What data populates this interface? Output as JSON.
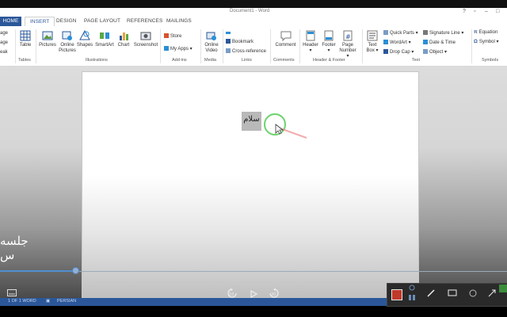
{
  "window": {
    "title": "Document1 - Word"
  },
  "tabs": [
    {
      "label": "HOME"
    },
    {
      "label": "INSERT"
    },
    {
      "label": "DESIGN"
    },
    {
      "label": "PAGE LAYOUT"
    },
    {
      "label": "REFERENCES"
    },
    {
      "label": "MAILINGS"
    }
  ],
  "ribbon": {
    "pages": {
      "partial_labels": [
        "age",
        "age",
        "eak"
      ]
    },
    "tables": {
      "table_label": "Table",
      "group_label": "Tables"
    },
    "illustrations": {
      "pictures": "Pictures",
      "online_pictures_1": "Online",
      "online_pictures_2": "Pictures",
      "shapes": "Shapes",
      "smartart": "SmartArt",
      "chart": "Chart",
      "screenshot": "Screenshot",
      "group_label": "Illustrations"
    },
    "addins": {
      "store": "Store",
      "my_apps": "My Apps",
      "group_label": "Add-ins"
    },
    "media": {
      "online_video_1": "Online",
      "online_video_2": "Video",
      "group_label": "Media"
    },
    "links": {
      "bookmark": "Bookmark",
      "cross_reference": "Cross-reference",
      "group_label": "Links"
    },
    "comments": {
      "comment": "Comment",
      "group_label": "Comments"
    },
    "header_footer": {
      "header": "Header",
      "footer": "Footer",
      "page_number_1": "Page",
      "page_number_2": "Number",
      "group_label": "Header & Footer"
    },
    "text": {
      "text_box_1": "Text",
      "text_box_2": "Box",
      "quick_parts": "Quick Parts",
      "wordart": "WordArt",
      "drop_cap": "Drop Cap",
      "signature_line": "Signature Line",
      "date_time": "Date & Time",
      "object": "Object",
      "group_label": "Text"
    },
    "symbols": {
      "equation": "Equation",
      "symbol": "Symbol",
      "group_label": "Symbols"
    }
  },
  "document": {
    "selected_text": "سلام"
  },
  "overlay": {
    "caption": "جلسه س"
  },
  "status": {
    "page": "1 OF 1 WORD",
    "language": "PERSIAN"
  },
  "player": {
    "progress": 0.15,
    "rewind_label": "10",
    "forward_label": "30"
  },
  "colors": {
    "word_blue": "#2b579a",
    "highlight_green": "#6cd36c",
    "record_red": "#c0392b"
  }
}
